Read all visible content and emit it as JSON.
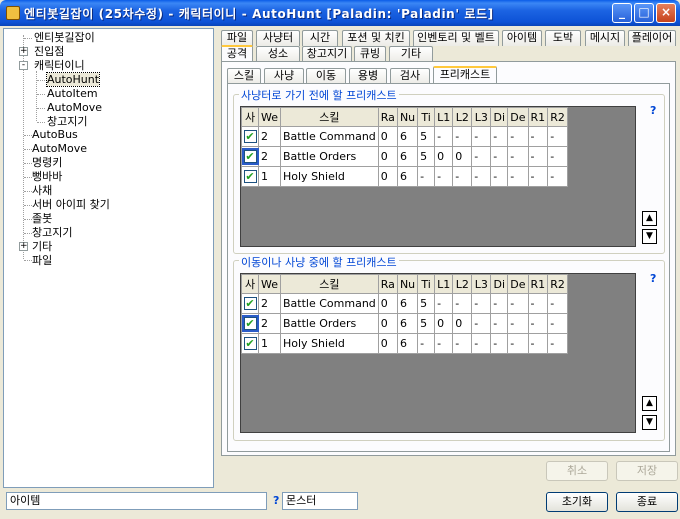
{
  "window": {
    "title": "엔티봇길잡이 (25차수정) - 캐릭터이니 - AutoHunt [Paladin: 'Paladin' 로드]",
    "min": "_",
    "max": "□",
    "close": "×"
  },
  "tree": {
    "items": [
      {
        "label": "엔티봇길잡이",
        "level": 0
      },
      {
        "label": "진입점",
        "level": 0
      },
      {
        "label": "캐릭터이니",
        "level": 0
      },
      {
        "label": "AutoHunt",
        "level": 1
      },
      {
        "label": "AutoItem",
        "level": 1
      },
      {
        "label": "AutoMove",
        "level": 1
      },
      {
        "label": "창고지기",
        "level": 1
      },
      {
        "label": "AutoBus",
        "level": 0
      },
      {
        "label": "AutoMove",
        "level": 0
      },
      {
        "label": "명령키",
        "level": 0
      },
      {
        "label": "뻥바바",
        "level": 0
      },
      {
        "label": "사채",
        "level": 0
      },
      {
        "label": "서버 아이피 찾기",
        "level": 0
      },
      {
        "label": "졸봇",
        "level": 0
      },
      {
        "label": "창고지기",
        "level": 0
      },
      {
        "label": "기타",
        "level": 0
      },
      {
        "label": "파일",
        "level": 0
      }
    ],
    "expanders": [
      "+",
      "-",
      "+"
    ]
  },
  "tabs_row1": [
    "파일",
    "사냥터",
    "시간",
    "포션 및 치킨",
    "인벤토리 및 벨트",
    "아이템",
    "도박",
    "메시지",
    "플레이어"
  ],
  "tabs_row2": [
    "공격",
    "성소",
    "창고지기",
    "큐빙",
    "기타"
  ],
  "subtabs": [
    "스킬",
    "사냥",
    "이동",
    "용병",
    "검사",
    "프리캐스트"
  ],
  "group1": {
    "title": "사냥터로 가기 전에 할 프리캐스트",
    "help": "?"
  },
  "group2": {
    "title": "이동이나 사냥 중에 할 프리캐스트",
    "help": "?"
  },
  "grid": {
    "headers": [
      "사",
      "We",
      "스킬",
      "Ra",
      "Nu",
      "Ti",
      "L1",
      "L2",
      "L3",
      "Di",
      "De",
      "R1",
      "R2"
    ],
    "rows": [
      {
        "checked": "✔",
        "cells": [
          "2",
          "Battle Command",
          "0",
          "6",
          "5",
          "-",
          "-",
          "-",
          "-",
          "-",
          "-",
          "-"
        ]
      },
      {
        "checked": "✔",
        "cells": [
          "2",
          "Battle Orders",
          "0",
          "6",
          "5",
          "0",
          "0",
          "-",
          "-",
          "-",
          "-",
          "-"
        ]
      },
      {
        "checked": "✔",
        "cells": [
          "1",
          "Holy Shield",
          "0",
          "6",
          "-",
          "-",
          "-",
          "-",
          "-",
          "-",
          "-",
          "-"
        ]
      }
    ]
  },
  "scroll": {
    "up": "▲",
    "down": "▼"
  },
  "buttons": {
    "cancel": "취소",
    "save": "저장",
    "reset": "초기화",
    "exit": "종료"
  },
  "status": {
    "item_label": "아이템",
    "question": "?",
    "monster_label": "몬스터"
  }
}
